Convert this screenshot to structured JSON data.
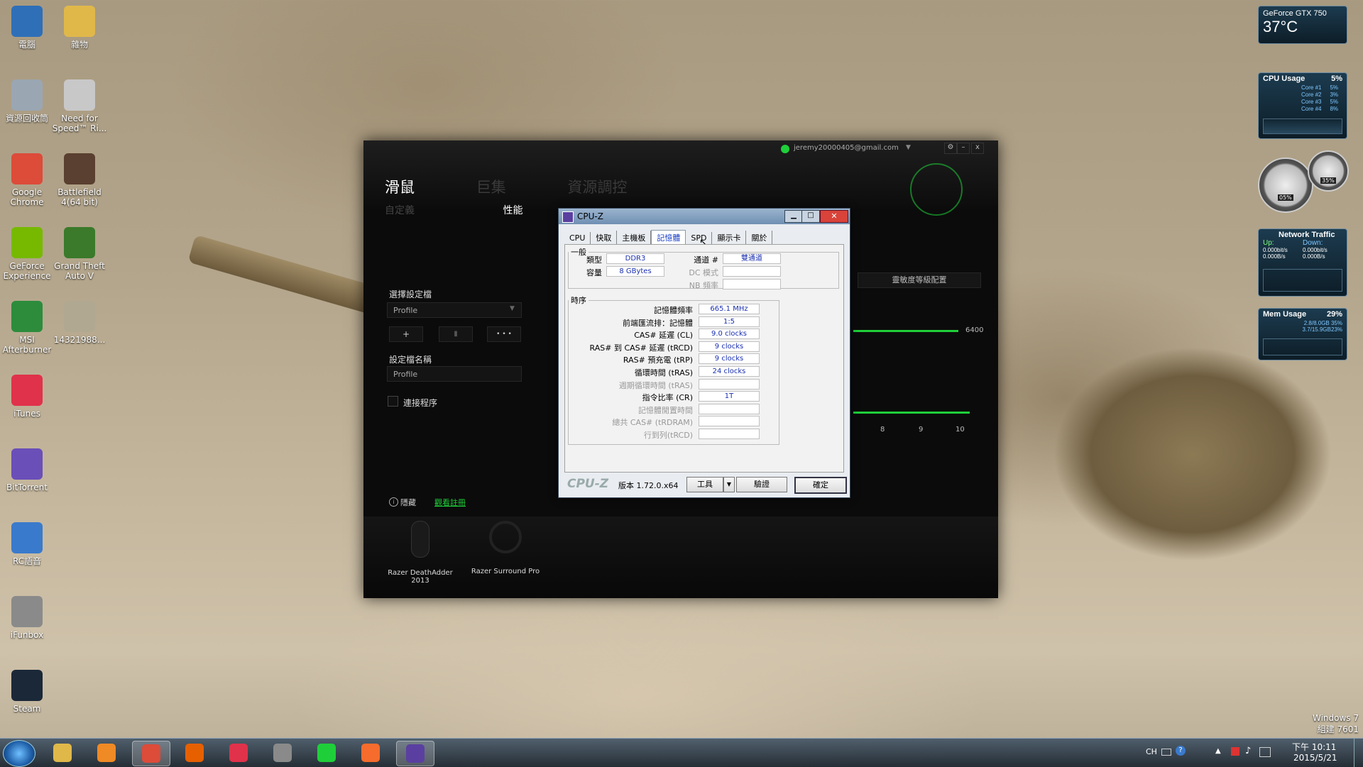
{
  "desktop_icons": [
    {
      "label": "電腦",
      "icon": "computer-icon",
      "color": "#2f6fb8"
    },
    {
      "label": "雜物",
      "icon": "folder-icon",
      "color": "#e0b84a"
    },
    {
      "label": "資源回收筒",
      "icon": "recycle-bin-icon",
      "color": "#9aa6b2"
    },
    {
      "label": "Need for Speed™ Ri...",
      "icon": "need-for-speed-icon",
      "color": "#c8c8c8"
    },
    {
      "label": "Google Chrome",
      "icon": "chrome-icon",
      "color": "#dd4b39"
    },
    {
      "label": "Battlefield 4(64 bit)",
      "icon": "battlefield-icon",
      "color": "#5a4030"
    },
    {
      "label": "GeForce Experience",
      "icon": "geforce-icon",
      "color": "#76b900"
    },
    {
      "label": "Grand Theft Auto V",
      "icon": "gta-icon",
      "color": "#3a7a2a"
    },
    {
      "label": "MSI Afterburner",
      "icon": "msi-afterburner-icon",
      "color": "#2c8c3c"
    },
    {
      "label": "14321988...",
      "icon": "image-file-icon",
      "color": "#b0a890"
    },
    {
      "label": "iTunes",
      "icon": "itunes-icon",
      "color": "#e0324a"
    },
    {
      "label": "BitTorrent",
      "icon": "bittorrent-icon",
      "color": "#6a4fb8"
    },
    {
      "label": "RC語音",
      "icon": "rc-voice-icon",
      "color": "#3a7acc"
    },
    {
      "label": "iFunbox",
      "icon": "ifunbox-icon",
      "color": "#8a8a8a"
    },
    {
      "label": "Steam",
      "icon": "steam-icon",
      "color": "#1b2838"
    }
  ],
  "gadgets": {
    "gpu": {
      "name": "GeForce GTX 750",
      "temp": "37°C"
    },
    "cpu": {
      "title": "CPU Usage",
      "value": "5%",
      "cores": [
        {
          "label": "Core #1",
          "value": "5%"
        },
        {
          "label": "Core #2",
          "value": "3%"
        },
        {
          "label": "Core #3",
          "value": "5%"
        },
        {
          "label": "Core #4",
          "value": "8%"
        }
      ]
    },
    "meters": {
      "left": "05%",
      "right": "35%"
    },
    "network": {
      "title": "Network Traffic",
      "up_label": "Up:",
      "down_label": "Down:",
      "up_bits": "0.000bit/s",
      "down_bits": "0.000bit/s",
      "up_bytes": "0.000B/s",
      "down_bytes": "0.000B/s"
    },
    "memory": {
      "title": "Mem Usage",
      "value": "29%",
      "row1": "2.8/8.0GB 35%",
      "row2": "3.7/15.9GB23%"
    }
  },
  "razer": {
    "account": "jeremy20000405@gmail.com",
    "nav": [
      "滑鼠",
      "巨集",
      "資源調控"
    ],
    "subnav": [
      "自定義",
      "性能"
    ],
    "select_profile_label": "選擇設定檔",
    "profile_select_value": "Profile",
    "buttons": [
      "+",
      "▮",
      "• • •"
    ],
    "profile_name_label": "設定檔名稱",
    "profile_name_value": "Profile",
    "link_program_label": "連接程序",
    "hide_label": "隱藏",
    "help_link": "觀看註冊",
    "right_field": "靈敏度等級配置",
    "right_value": "6400",
    "ticks": [
      "8",
      "9",
      "10"
    ],
    "devices": [
      "Razer DeathAdder 2013",
      "Razer Surround Pro"
    ]
  },
  "cpuz": {
    "title": "CPU-Z",
    "tabs": [
      "CPU",
      "快取",
      "主機板",
      "記憶體",
      "SPD",
      "顯示卡",
      "關於"
    ],
    "active_tab": "記憶體",
    "general_legend": "一般",
    "type_label": "類型",
    "type_value": "DDR3",
    "size_label": "容量",
    "size_value": "8 GBytes",
    "channel_label": "通道 #",
    "channel_value": "雙通道",
    "dc_label": "DC 模式",
    "nb_label": "NB 頻率",
    "timing_legend": "時序",
    "timings": [
      {
        "label": "記憶體頻率",
        "value": "665.1 MHz",
        "enabled": true
      },
      {
        "label": "前端匯流排：記憶體",
        "value": "1:5",
        "enabled": true
      },
      {
        "label": "CAS# 延遲 (CL)",
        "value": "9.0 clocks",
        "enabled": true
      },
      {
        "label": "RAS# 到 CAS# 延遲 (tRCD)",
        "value": "9 clocks",
        "enabled": true
      },
      {
        "label": "RAS# 預充電 (tRP)",
        "value": "9 clocks",
        "enabled": true
      },
      {
        "label": "循環時間 (tRAS)",
        "value": "24 clocks",
        "enabled": true
      },
      {
        "label": "週期循環時間 (tRAS)",
        "value": "",
        "enabled": false
      },
      {
        "label": "指令比率 (CR)",
        "value": "1T",
        "enabled": true
      },
      {
        "label": "記憶體閒置時間",
        "value": "",
        "enabled": false
      },
      {
        "label": "總共 CAS# (tRDRAM)",
        "value": "",
        "enabled": false
      },
      {
        "label": "行到列(tRCD)",
        "value": "",
        "enabled": false
      }
    ],
    "brand": "CPU-Z",
    "version": "版本 1.72.0.x64",
    "tools_button": "工具",
    "validate_button": "驗證",
    "ok_button": "確定"
  },
  "taskbar": {
    "items": [
      {
        "name": "explorer",
        "color": "#e0b84a"
      },
      {
        "name": "media-player",
        "color": "#f08a24"
      },
      {
        "name": "chrome",
        "color": "#dd4b39"
      },
      {
        "name": "firefox",
        "color": "#e66000"
      },
      {
        "name": "itunes",
        "color": "#e0324a"
      },
      {
        "name": "ifunbox",
        "color": "#8a8a8a"
      },
      {
        "name": "razer-synapse",
        "color": "#1fcf3a"
      },
      {
        "name": "origin",
        "color": "#f56c2d"
      },
      {
        "name": "cpu-z",
        "color": "#5a3fa0"
      }
    ],
    "lang": "CH",
    "time": "下午 10:11",
    "date": "2015/5/21"
  },
  "watermark": {
    "line1": "Windows 7",
    "line2": "組建 7601"
  }
}
